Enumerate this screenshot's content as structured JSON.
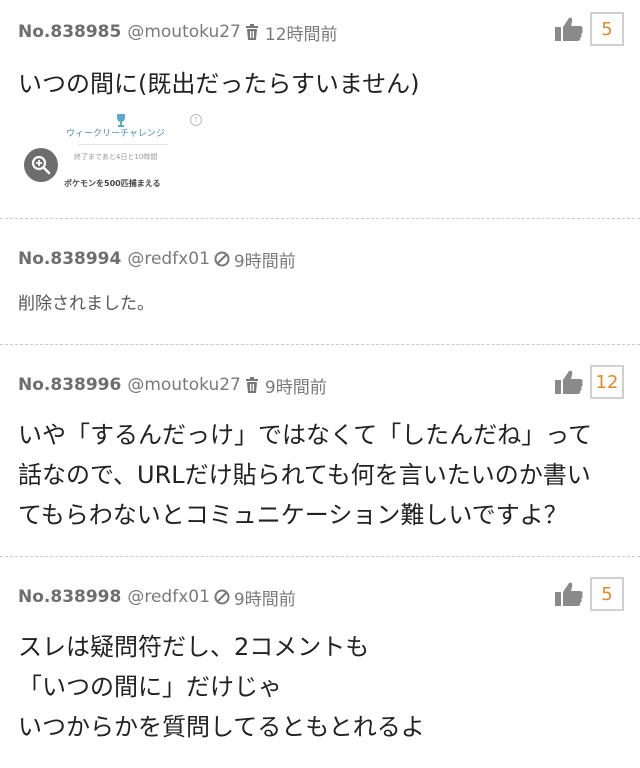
{
  "colors": {
    "accent": "#e08a2a",
    "meta": "#777777",
    "divider": "#c9c9c9"
  },
  "posts": [
    {
      "no": "No.838985",
      "user": "@moutoku27",
      "mark_icon": "trash-icon",
      "time": "12時間前",
      "likes": "5",
      "text": "いつの間に(既出だったらすいません)",
      "image": {
        "title": "ウィークリーチャレンジ",
        "sub": "終了まであと4日と10時間",
        "foot": "ポケモンを500匹捕まえる"
      }
    },
    {
      "no": "No.838994",
      "user": "@redfx01",
      "mark_icon": "no-entry-icon",
      "time": "9時間前",
      "text": "削除されました。"
    },
    {
      "no": "No.838996",
      "user": "@moutoku27",
      "mark_icon": "trash-icon",
      "time": "9時間前",
      "likes": "12",
      "lines": [
        "いや「するんだっけ」ではなくて「したんだね」って",
        "話なので、URLだけ貼られても何を言いたいのか書い",
        "てもらわないとコミュニケーション難しいですよ？"
      ]
    },
    {
      "no": "No.838998",
      "user": "@redfx01",
      "mark_icon": "no-entry-icon",
      "time": "9時間前",
      "likes": "5",
      "lines": [
        "スレは疑問符だし、2コメントも",
        "「いつの間に」だけじゃ",
        "いつからかを質問してるともとれるよ"
      ]
    }
  ]
}
